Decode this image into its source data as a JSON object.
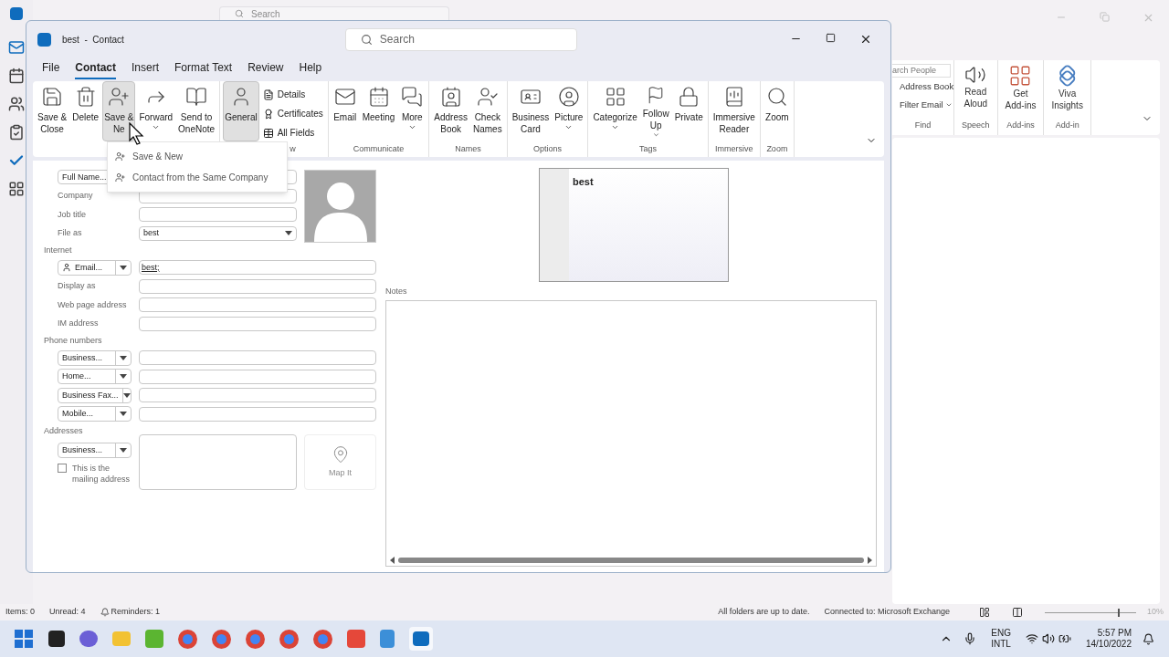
{
  "main_window": {
    "search_placeholder": "Search",
    "people_search_placeholder": "arch People",
    "find_items": [
      {
        "label": "Address Book",
        "dropdown": false
      },
      {
        "label": "Filter Email",
        "dropdown": true
      }
    ],
    "groups": [
      {
        "label": "Find"
      },
      {
        "label": "Speech",
        "buttons": [
          {
            "lines": [
              "Read",
              "Aloud"
            ]
          }
        ]
      },
      {
        "label": "Add-ins",
        "buttons": [
          {
            "lines": [
              "Get",
              "Add-ins"
            ]
          }
        ]
      },
      {
        "label": "Add-in",
        "buttons": [
          {
            "lines": [
              "Viva",
              "Insights"
            ]
          }
        ]
      }
    ],
    "status_bar": {
      "left": [
        "Items: 0",
        "Unread: 4",
        "Reminders: 1"
      ],
      "right": [
        "All folders are up to date.",
        "Connected to: Microsoft Exchange"
      ],
      "zoom": {
        "level": 0.8,
        "reading": "10%"
      }
    }
  },
  "contact_window": {
    "title": "best  -  Contact",
    "search_placeholder": "Search",
    "tabs": [
      {
        "label": "File",
        "selected": false
      },
      {
        "label": "Contact",
        "selected": true
      },
      {
        "label": "Insert",
        "selected": false
      },
      {
        "label": "Format Text",
        "selected": false
      },
      {
        "label": "Review",
        "selected": false
      },
      {
        "label": "Help",
        "selected": false
      }
    ],
    "ribbon_groups": [
      {
        "buttons": [
          {
            "lines": [
              "Save &",
              "Close"
            ],
            "dropdown": false,
            "pressed": false
          },
          {
            "lines": [
              "Delete"
            ],
            "dropdown": false,
            "pressed": false
          },
          {
            "lines": [
              "Save &",
              "Ne"
            ],
            "dropdown": false,
            "pressed": true
          },
          {
            "lines": [
              "Forward"
            ],
            "dropdown": true,
            "pressed": false
          },
          {
            "lines": [
              "Send to",
              "OneNote"
            ],
            "dropdown": false,
            "pressed": false
          }
        ]
      },
      {
        "label": "w",
        "buttons": [
          {
            "lines": [
              "General"
            ],
            "dropdown": false,
            "pressed": true
          }
        ],
        "small": [
          "Details",
          "Certificates",
          "All Fields"
        ]
      },
      {
        "label": "Communicate",
        "buttons": [
          {
            "lines": [
              "Email"
            ],
            "dropdown": false,
            "pressed": false
          },
          {
            "lines": [
              "Meeting"
            ],
            "dropdown": false,
            "pressed": false
          },
          {
            "lines": [
              "More"
            ],
            "dropdown": true,
            "pressed": false
          }
        ]
      },
      {
        "label": "Names",
        "buttons": [
          {
            "lines": [
              "Address",
              "Book"
            ],
            "dropdown": false,
            "pressed": false
          },
          {
            "lines": [
              "Check",
              "Names"
            ],
            "dropdown": false,
            "pressed": false
          }
        ]
      },
      {
        "label": "Options",
        "buttons": [
          {
            "lines": [
              "Business",
              "Card"
            ],
            "dropdown": false,
            "pressed": false
          },
          {
            "lines": [
              "Picture"
            ],
            "dropdown": true,
            "pressed": false
          }
        ]
      },
      {
        "label": "Tags",
        "buttons": [
          {
            "lines": [
              "Categorize"
            ],
            "dropdown": true,
            "pressed": false
          },
          {
            "lines": [
              "Follow",
              "Up"
            ],
            "dropdown": true,
            "pressed": false
          },
          {
            "lines": [
              "Private"
            ],
            "dropdown": false,
            "pressed": false
          }
        ]
      },
      {
        "label": "Immersive",
        "buttons": [
          {
            "lines": [
              "Immersive",
              "Reader"
            ],
            "dropdown": false,
            "pressed": false
          }
        ]
      },
      {
        "label": "Zoom",
        "buttons": [
          {
            "lines": [
              "Zoom"
            ],
            "dropdown": false,
            "pressed": false
          }
        ]
      }
    ],
    "menu": [
      "Save & New",
      "Contact from the Same Company"
    ],
    "form": [
      {
        "kind": "button",
        "label": "Full Name...",
        "wide": false
      },
      {
        "kind": "label",
        "label": "Company",
        "wide": false
      },
      {
        "kind": "label",
        "label": "Job title",
        "wide": false
      },
      {
        "kind": "select",
        "label": "File as",
        "value": "best"
      },
      {
        "kind": "section",
        "label": "Internet"
      },
      {
        "kind": "email",
        "label": "Email...",
        "value": "best;",
        "wide": true
      },
      {
        "kind": "label",
        "label": "Display as",
        "wide": true
      },
      {
        "kind": "label",
        "label": "Web page address",
        "wide": true
      },
      {
        "kind": "label",
        "label": "IM address",
        "wide": true
      },
      {
        "kind": "section",
        "label": "Phone numbers"
      },
      {
        "kind": "dropdown",
        "label": "Business...",
        "wide": true
      },
      {
        "kind": "dropdown",
        "label": "Home...",
        "wide": true
      },
      {
        "kind": "dropdown",
        "label": "Business Fax...",
        "wide": true
      },
      {
        "kind": "dropdown",
        "label": "Mobile...",
        "wide": true
      },
      {
        "kind": "section",
        "label": "Addresses"
      }
    ],
    "address": {
      "type": "Business...",
      "mailing_label": "This is the mailing address",
      "checked": false,
      "map_label": "Map It",
      "map_disabled": true
    },
    "card_name": "best",
    "notes_label": "Notes"
  },
  "taskbar": {
    "lang": [
      "ENG",
      "INTL"
    ],
    "time": "5:57 PM",
    "date": "14/10/2022"
  }
}
